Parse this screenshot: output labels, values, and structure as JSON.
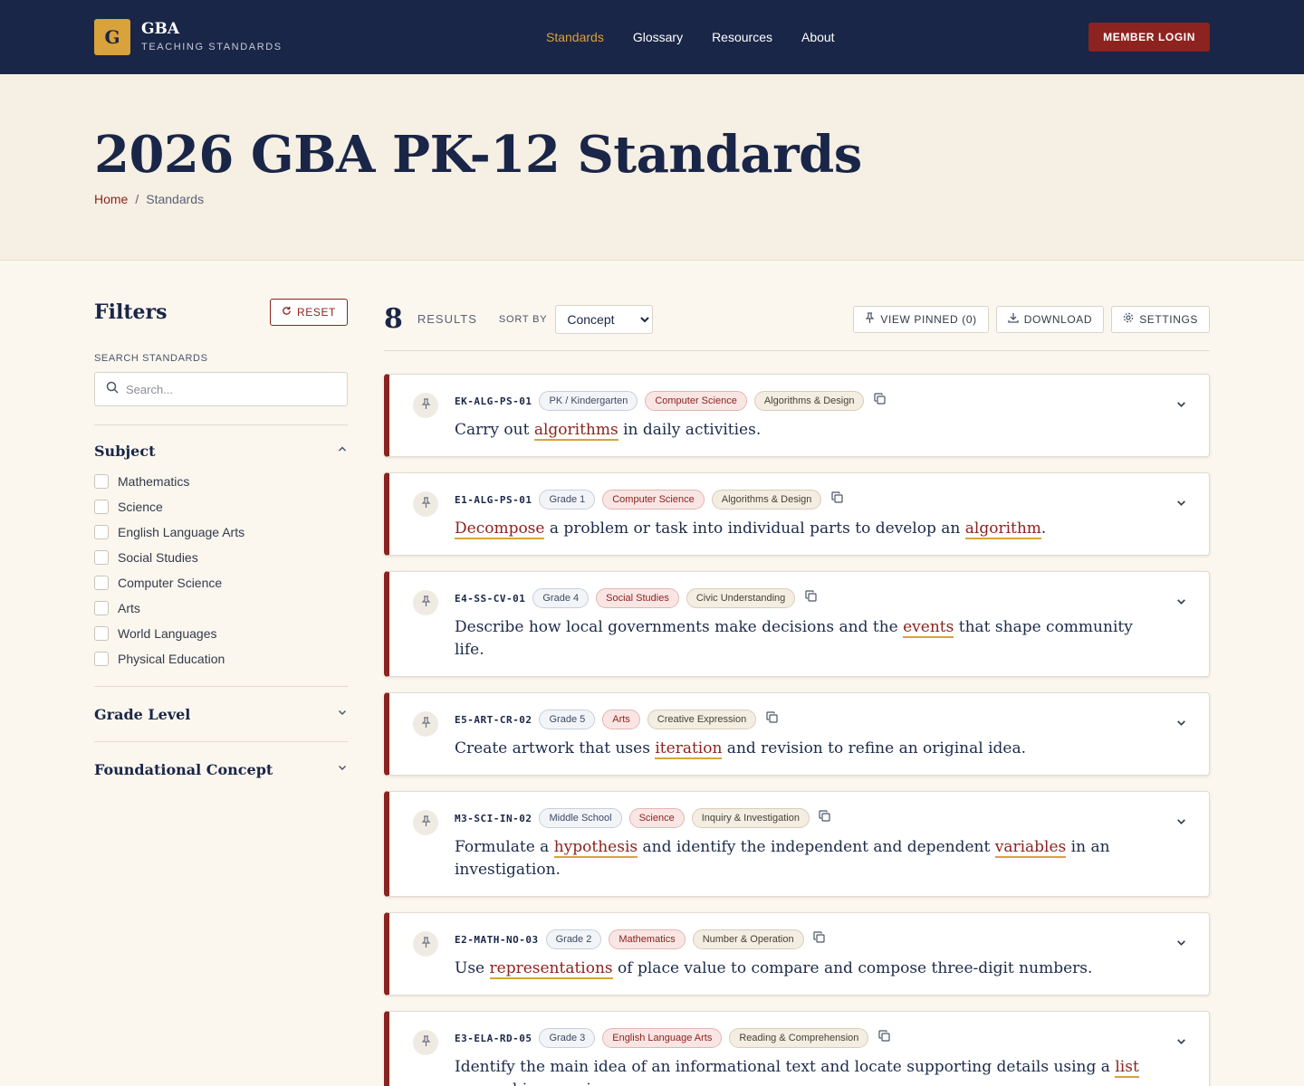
{
  "header": {
    "logo_letter": "G",
    "logo_name": "GBA",
    "logo_sub": "TEACHING STANDARDS",
    "nav": [
      {
        "label": "Standards"
      },
      {
        "label": "Glossary"
      },
      {
        "label": "Resources"
      },
      {
        "label": "About"
      }
    ],
    "active_nav": "Standards",
    "login_label": "MEMBER LOGIN"
  },
  "hero": {
    "title": "2026 GBA PK-12 Standards",
    "breadcrumb_home": "Home",
    "breadcrumb_sep": "/",
    "breadcrumb_current": "Standards"
  },
  "filters": {
    "title": "Filters",
    "reset_label": "RESET",
    "search_label": "SEARCH STANDARDS",
    "search_placeholder": "Search...",
    "subject_title": "Subject",
    "subjects": [
      "Mathematics",
      "Science",
      "English Language Arts",
      "Social Studies",
      "Computer Science",
      "Arts",
      "World Languages",
      "Physical Education"
    ],
    "grade_title": "Grade Level",
    "concept_title": "Foundational Concept"
  },
  "results": {
    "count": "8",
    "label": "RESULTS",
    "sort_label": "SORT BY",
    "sort_value": "Concept",
    "view_pinned_label": "VIEW PINNED (0)",
    "download_label": "DOWNLOAD",
    "settings_label": "SETTINGS"
  },
  "standards": [
    {
      "code": "EK-ALG-PS-01",
      "grade": "PK / Kindergarten",
      "subject": "Computer Science",
      "concept": "Algorithms & Design",
      "description": [
        {
          "t": "Carry out "
        },
        {
          "t": "algorithms",
          "term": true
        },
        {
          "t": " in daily activities."
        }
      ]
    },
    {
      "code": "E1-ALG-PS-01",
      "grade": "Grade 1",
      "subject": "Computer Science",
      "concept": "Algorithms & Design",
      "description": [
        {
          "t": "Decompose",
          "term": true
        },
        {
          "t": " a problem or task into individual parts to develop an "
        },
        {
          "t": "algorithm",
          "term": true
        },
        {
          "t": "."
        }
      ]
    },
    {
      "code": "E4-SS-CV-01",
      "grade": "Grade 4",
      "subject": "Social Studies",
      "concept": "Civic Understanding",
      "description": [
        {
          "t": "Describe how local governments make decisions and the "
        },
        {
          "t": "events",
          "term": true
        },
        {
          "t": " that shape community life."
        }
      ]
    },
    {
      "code": "E5-ART-CR-02",
      "grade": "Grade 5",
      "subject": "Arts",
      "concept": "Creative Expression",
      "description": [
        {
          "t": "Create artwork that uses "
        },
        {
          "t": "iteration",
          "term": true
        },
        {
          "t": " and revision to refine an original idea."
        }
      ]
    },
    {
      "code": "M3-SCI-IN-02",
      "grade": "Middle School",
      "subject": "Science",
      "concept": "Inquiry & Investigation",
      "description": [
        {
          "t": "Formulate a "
        },
        {
          "t": "hypothesis",
          "term": true
        },
        {
          "t": " and identify the independent and dependent "
        },
        {
          "t": "variables",
          "term": true
        },
        {
          "t": " in an investigation."
        }
      ]
    },
    {
      "code": "E2-MATH-NO-03",
      "grade": "Grade 2",
      "subject": "Mathematics",
      "concept": "Number & Operation",
      "description": [
        {
          "t": "Use "
        },
        {
          "t": "representations",
          "term": true
        },
        {
          "t": " of place value to compare and compose three-digit numbers."
        }
      ]
    },
    {
      "code": "E3-ELA-RD-05",
      "grade": "Grade 3",
      "subject": "English Language Arts",
      "concept": "Reading & Comprehension",
      "description": [
        {
          "t": "Identify the main idea of an informational text and locate supporting details using a "
        },
        {
          "t": "list",
          "term": true
        },
        {
          "t": " or graphic organizer."
        }
      ]
    }
  ],
  "colors": {
    "navy": "#1a2647",
    "gold": "#d9a23a",
    "crimson": "#8c231e",
    "cream": "#fbf7ef"
  },
  "icons": {
    "pin": "pin-icon",
    "copy": "copy-icon",
    "chevron": "chevron-down-icon",
    "search": "search-icon",
    "reset": "refresh-icon",
    "download": "download-icon",
    "settings": "gear-icon"
  }
}
